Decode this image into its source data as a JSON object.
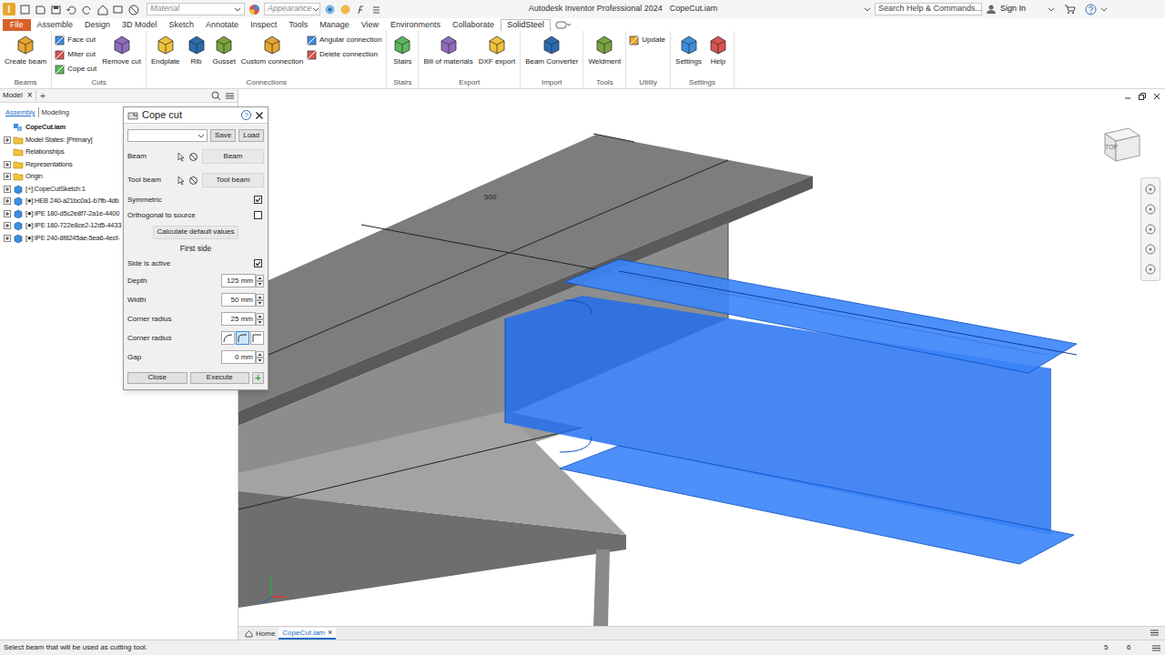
{
  "titlebar": {
    "logo": "I",
    "material": "Material",
    "appearance": "Appearance",
    "app": "Autodesk Inventor Professional 2024",
    "document": "CopeCut.iam",
    "search": "Search Help & Commands...",
    "sign_in": "Sign In"
  },
  "menu_tabs": [
    {
      "label": "File",
      "selected": false
    },
    {
      "label": "Assemble",
      "selected": false
    },
    {
      "label": "Design",
      "selected": false
    },
    {
      "label": "3D Model",
      "selected": false
    },
    {
      "label": "Sketch",
      "selected": false
    },
    {
      "label": "Annotate",
      "selected": false
    },
    {
      "label": "Inspect",
      "selected": false
    },
    {
      "label": "Tools",
      "selected": false
    },
    {
      "label": "Manage",
      "selected": false
    },
    {
      "label": "View",
      "selected": false
    },
    {
      "label": "Environments",
      "selected": false
    },
    {
      "label": "Collaborate",
      "selected": false
    },
    {
      "label": "SolidSteel",
      "selected": true
    }
  ],
  "ribbon": {
    "groups": [
      {
        "label": "Beams",
        "tools": [
          {
            "label": "Create beam",
            "kind": "large"
          }
        ]
      },
      {
        "label": "Cuts",
        "tools": [
          {
            "label": "Face cut",
            "kind": "small"
          },
          {
            "label": "Miter cut",
            "kind": "small"
          },
          {
            "label": "Cope cut",
            "kind": "small"
          },
          {
            "label": "Remove cut",
            "kind": "large"
          }
        ]
      },
      {
        "label": "Connections",
        "tools": [
          {
            "label": "Endplate",
            "kind": "large"
          },
          {
            "label": "Rib",
            "kind": "large"
          },
          {
            "label": "Gusset",
            "kind": "large"
          },
          {
            "label": "Custom connection",
            "kind": "large"
          },
          {
            "label": "Angular connection",
            "kind": "small"
          },
          {
            "label": "Delete connection",
            "kind": "small"
          }
        ]
      },
      {
        "label": "Stairs",
        "tools": [
          {
            "label": "Stairs",
            "kind": "large"
          }
        ]
      },
      {
        "label": "Export",
        "tools": [
          {
            "label": "Bill of materials",
            "kind": "large"
          },
          {
            "label": "DXF export",
            "kind": "large"
          }
        ]
      },
      {
        "label": "Import",
        "tools": [
          {
            "label": "Beam Converter",
            "kind": "large"
          }
        ]
      },
      {
        "label": "Tools",
        "tools": [
          {
            "label": "Weldment",
            "kind": "large"
          }
        ]
      },
      {
        "label": "Utility",
        "tools": [
          {
            "label": "Update",
            "kind": "small"
          }
        ]
      },
      {
        "label": "Settings",
        "tools": [
          {
            "label": "Settings",
            "kind": "large"
          },
          {
            "label": "Help",
            "kind": "large"
          }
        ]
      }
    ]
  },
  "browser": {
    "tab": "Model",
    "close": "×",
    "add": "+",
    "subtabs": [
      {
        "label": "Assembly",
        "selected": true
      },
      {
        "label": "Modeling",
        "selected": false
      }
    ],
    "items": [
      {
        "label": "CopeCut.iam",
        "kind": "assembly",
        "expandable": false,
        "expanded": true
      },
      {
        "label": "Model States: [Primary]",
        "kind": "folder",
        "expandable": true,
        "expanded": false
      },
      {
        "label": "Relationships",
        "kind": "folder",
        "expandable": false,
        "expanded": false
      },
      {
        "label": "Representations",
        "kind": "folder",
        "expandable": true,
        "expanded": false
      },
      {
        "label": "Origin",
        "kind": "folder",
        "expandable": true,
        "expanded": false
      },
      {
        "label": "[+]:CopeCutSketch:1",
        "kind": "part",
        "expandable": true,
        "expanded": false
      },
      {
        "label": "[●]:HEB 240-a21bc0a1-b7fb-4db",
        "kind": "part",
        "expandable": true,
        "expanded": false
      },
      {
        "label": "[●]:IPE 180-d5c2e8f7-2a1e-4400",
        "kind": "part",
        "expandable": true,
        "expanded": false
      },
      {
        "label": "[●]:IPE 180-722e8ce2-12d5-4433",
        "kind": "part",
        "expandable": true,
        "expanded": false
      },
      {
        "label": "[●]:IPE 240-8f8245ae-5ea6-4ecf-",
        "kind": "part",
        "expandable": true,
        "expanded": false
      }
    ]
  },
  "dialog": {
    "title": "Cope cut",
    "help": "?",
    "save": "Save",
    "load": "Load",
    "beam_label": "Beam",
    "beam_button": "Beam",
    "tool_label": "Tool beam",
    "tool_button": "Tool beam",
    "symmetric": {
      "label": "Symmetric",
      "checked": true
    },
    "orthogonal": {
      "label": "Orthogonal to source",
      "checked": false
    },
    "calculate": "Calculate default values",
    "section": "First side",
    "side_active": {
      "label": "Side is active",
      "checked": true
    },
    "rows": [
      {
        "kind": "field",
        "label": "Depth",
        "value": "125 mm"
      },
      {
        "kind": "field",
        "label": "Width",
        "value": "50 mm"
      },
      {
        "kind": "field",
        "label": "Corner radius",
        "value": "25 mm"
      },
      {
        "kind": "styles",
        "label": "Corner radius",
        "options": [
          {
            "selected": false
          },
          {
            "selected": true
          },
          {
            "selected": false
          }
        ]
      },
      {
        "kind": "field",
        "label": "Gap",
        "value": "0 mm"
      }
    ],
    "close": "Close",
    "execute": "Execute",
    "add": "+"
  },
  "viewport": {
    "dimension": "500",
    "viewcube": "TOP",
    "doc_tabs": [
      {
        "label": "Home",
        "selected": false,
        "closable": false
      },
      {
        "label": "CopeCut.iam",
        "selected": true,
        "closable": true
      }
    ],
    "tab_close": "×"
  },
  "status_bar": {
    "prompt": "Select beam that will be used as cutting tool.",
    "numbers": [
      "5",
      "6"
    ]
  }
}
